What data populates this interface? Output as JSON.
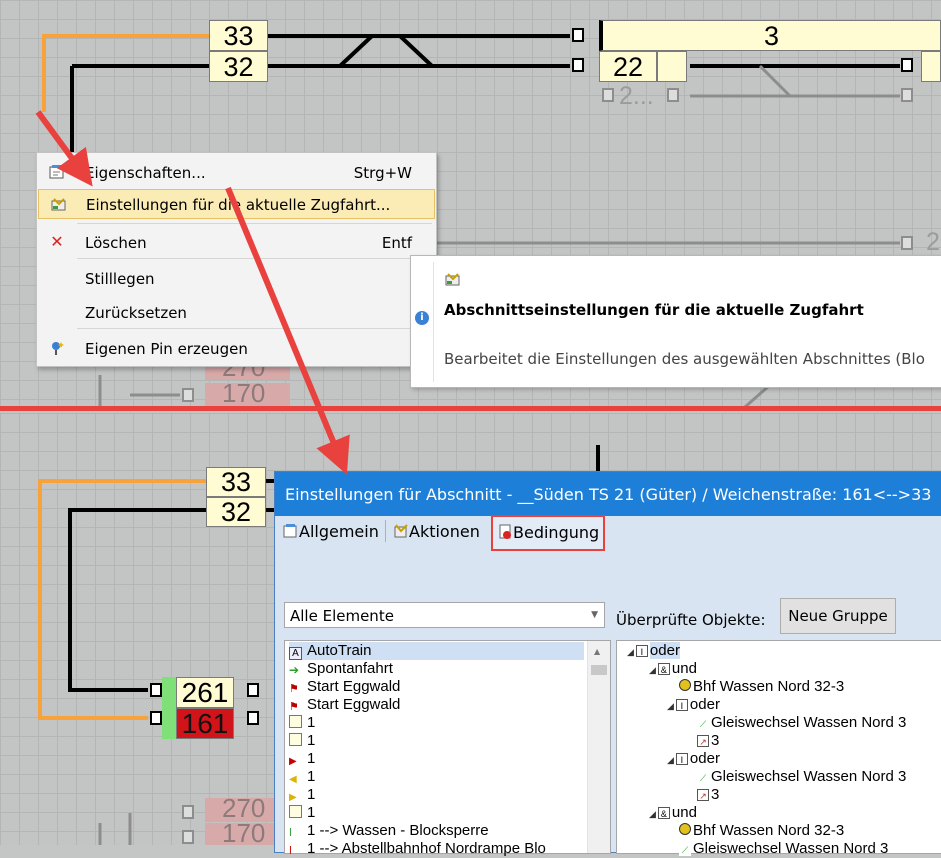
{
  "track_top": {
    "box_33": "33",
    "box_32": "32",
    "box_3": "3",
    "box_22": "22",
    "ghost_2": "2...",
    "ghost_2b": "2",
    "ghost_270": "270",
    "ghost_170": "170"
  },
  "context_menu": {
    "items": [
      {
        "label": "Eigenschaften...",
        "shortcut": "Strg+W",
        "icon": "properties-icon"
      },
      {
        "label": "Einstellungen für die aktuelle Zugfahrt...",
        "shortcut": "",
        "icon": "settings-icon"
      },
      {
        "label": "Löschen",
        "shortcut": "Entf",
        "icon": "delete-x-icon"
      },
      {
        "label": "Stilllegen",
        "shortcut": "",
        "icon": ""
      },
      {
        "label": "Zurücksetzen",
        "shortcut": "",
        "icon": ""
      },
      {
        "label": "Eigenen Pin erzeugen",
        "shortcut": "",
        "icon": "pin-icon"
      }
    ]
  },
  "tooltip": {
    "title": "Abschnittseinstellungen für die aktuelle Zugfahrt",
    "description": "Bearbeitet die Einstellungen des ausgewählten Abschnittes (Blo"
  },
  "track_bottom": {
    "box_33": "33",
    "box_32": "32",
    "box_261": "261",
    "box_161": "161",
    "ghost_270": "270",
    "ghost_170": "170"
  },
  "dialog": {
    "title": "Einstellungen für Abschnitt - __Süden TS 21 (Güter) / Weichenstraße: 161<-->33",
    "tabs": [
      "Allgemein",
      "Aktionen",
      "Bedingung"
    ],
    "filter_value": "Alle Elemente",
    "checked_objects_label": "Überprüfte Objekte:",
    "new_group_button": "Neue Gruppe",
    "elements_list": [
      {
        "text": "AutoTrain",
        "icon": "autotrain-icon"
      },
      {
        "text": "Spontanfahrt",
        "icon": "spontan-arrow-icon"
      },
      {
        "text": "Start Eggwald",
        "icon": "flag-icon"
      },
      {
        "text": "Start Eggwald",
        "icon": "flag-icon"
      },
      {
        "text": "1",
        "icon": "box-icon"
      },
      {
        "text": "1",
        "icon": "box-icon"
      },
      {
        "text": "1",
        "icon": "signal-red-icon"
      },
      {
        "text": "1",
        "icon": "signal-yellow-left-icon"
      },
      {
        "text": "1",
        "icon": "signal-yellow-right-icon"
      },
      {
        "text": "1",
        "icon": "box-icon"
      },
      {
        "text": "1 --> Wassen - Blocksperre",
        "icon": "route-icon"
      },
      {
        "text": "1 --> Abstellbahnhof Nordrampe Blo",
        "icon": "route-icon"
      }
    ],
    "tree": [
      {
        "text": "oder",
        "level": 0,
        "icon": "or-icon",
        "expander": "◢"
      },
      {
        "text": "und",
        "level": 1,
        "icon": "and-icon",
        "expander": "◢"
      },
      {
        "text": "Bhf Wassen Nord 32-3",
        "level": 2,
        "icon": "block-icon",
        "expander": ""
      },
      {
        "text": "oder",
        "level": 2,
        "icon": "or-icon",
        "expander": "◢"
      },
      {
        "text": "Gleiswechsel Wassen Nord 3",
        "level": 3,
        "icon": "switch-icon",
        "expander": ""
      },
      {
        "text": "3",
        "level": 3,
        "icon": "state-icon",
        "expander": ""
      },
      {
        "text": "oder",
        "level": 2,
        "icon": "or-icon",
        "expander": "◢"
      },
      {
        "text": "Gleiswechsel Wassen Nord 3",
        "level": 3,
        "icon": "switch-icon",
        "expander": ""
      },
      {
        "text": "3",
        "level": 3,
        "icon": "state-icon",
        "expander": ""
      },
      {
        "text": "und",
        "level": 1,
        "icon": "and-icon",
        "expander": "◢"
      },
      {
        "text": "Bhf Wassen Nord 32-3",
        "level": 2,
        "icon": "block-icon",
        "expander": ""
      },
      {
        "text": "Gleiswechsel Wassen Nord 3",
        "level": 2,
        "icon": "switch-icon",
        "expander": ""
      }
    ]
  },
  "colors": {
    "orange_track": "#f7a23b",
    "annotation_red": "#e8413e",
    "dialog_titlebar": "#1e7fd9",
    "block_red": "#d0141a",
    "block_green": "#7fe07a"
  }
}
